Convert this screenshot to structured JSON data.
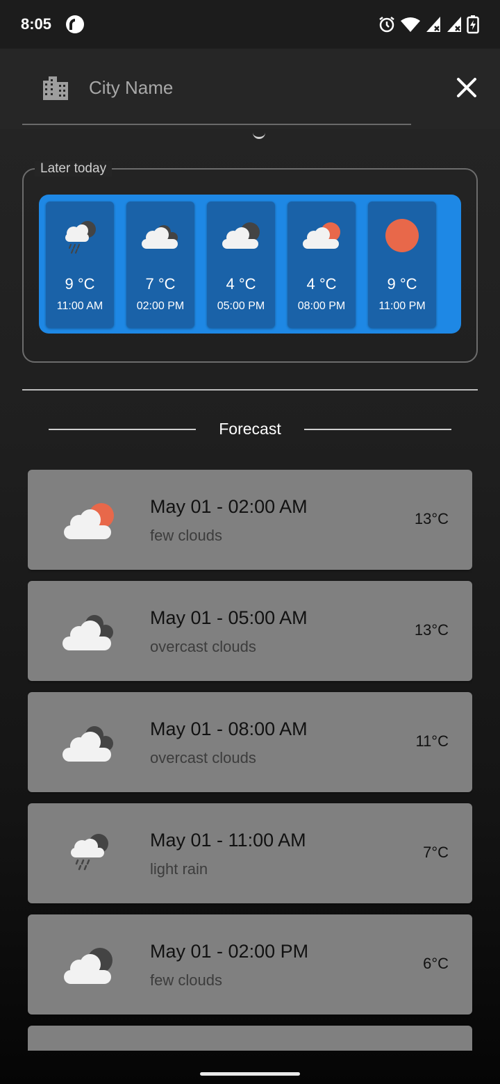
{
  "status_bar": {
    "time": "8:05",
    "app_icon": "pocket-casts-icon",
    "right_icons": [
      "alarm-icon",
      "wifi-icon",
      "signal-icon",
      "signal-icon",
      "battery-charging-icon"
    ]
  },
  "search": {
    "icon": "city-building-icon",
    "placeholder": "City Name",
    "value": "",
    "close_icon": "close-icon"
  },
  "later_today": {
    "label": "Later today",
    "accent_color": "#1e88e5",
    "hours": [
      {
        "icon": "rain-cloud-icon",
        "temp": "9 °C",
        "time": "11:00 AM"
      },
      {
        "icon": "overcast-cloud-icon",
        "temp": "7 °C",
        "time": "02:00 PM"
      },
      {
        "icon": "cloud-dark-sun-icon",
        "temp": "4 °C",
        "time": "05:00 PM"
      },
      {
        "icon": "cloud-sun-icon",
        "temp": "4 °C",
        "time": "08:00 PM"
      },
      {
        "icon": "sun-icon",
        "temp": "9 °C",
        "time": "11:00 PM"
      }
    ]
  },
  "forecast": {
    "title": "Forecast",
    "items": [
      {
        "icon": "cloud-sun-icon",
        "datetime": "May 01 - 02:00 AM",
        "description": "few clouds",
        "temp": "13°C"
      },
      {
        "icon": "overcast-cloud-icon",
        "datetime": "May 01 - 05:00 AM",
        "description": "overcast clouds",
        "temp": "13°C"
      },
      {
        "icon": "overcast-cloud-icon",
        "datetime": "May 01 - 08:00 AM",
        "description": "overcast clouds",
        "temp": "11°C"
      },
      {
        "icon": "rain-cloud-icon",
        "datetime": "May 01 - 11:00 AM",
        "description": "light rain",
        "temp": "7°C"
      },
      {
        "icon": "cloud-dark-sun-icon",
        "datetime": "May 01 - 02:00 PM",
        "description": "few clouds",
        "temp": "6°C"
      }
    ]
  },
  "colors": {
    "sun": "#e8684a",
    "cloud": "#f2f2f2",
    "dark_cloud": "#444444",
    "card": "#808080"
  }
}
